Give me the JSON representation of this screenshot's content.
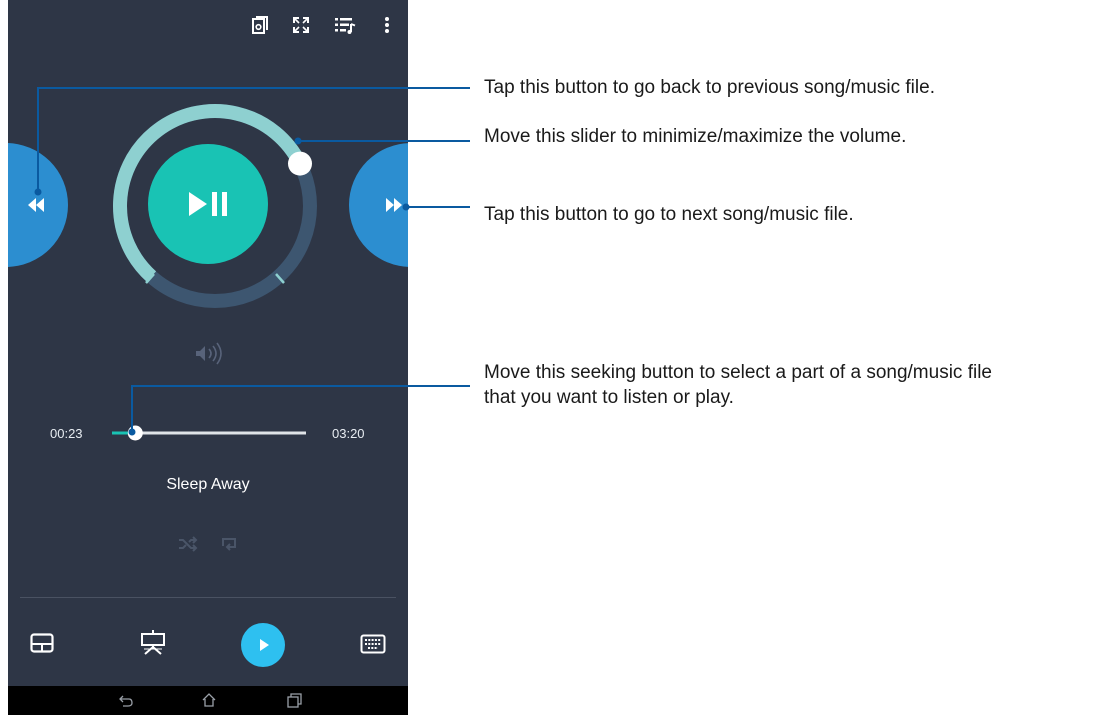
{
  "player": {
    "time_elapsed": "00:23",
    "time_total": "03:20",
    "song_title": "Sleep Away",
    "seek_progress": 0.12,
    "volume_level": 0.73
  },
  "top_bar": {
    "icons": [
      "cast-icon",
      "fullscreen-icon",
      "playlist-icon",
      "more-vert-icon"
    ]
  },
  "bottom_bar": {
    "icons": [
      "touchpad-icon",
      "presentation-icon",
      "play-icon",
      "keyboard-icon"
    ]
  },
  "nav_bar": {
    "icons": [
      "back-icon",
      "home-icon",
      "recents-icon"
    ]
  },
  "callouts": {
    "previous": "Tap this button to go back to previous song/music file.",
    "volume": "Move this slider to minimize/maximize the volume.",
    "next": "Tap this button to go to next song/music file.",
    "seek_line1": "Move this seeking button to select a part of a song/music file",
    "seek_line2": "that you want to listen or play."
  },
  "colors": {
    "screen_bg": "#2e3646",
    "accent_teal": "#19c3b4",
    "volume_ring": "#8ed0d0",
    "side_button_blue": "#2c8ed0",
    "play_button": "#2ec0f0",
    "callout_line": "#0a5aa0"
  }
}
